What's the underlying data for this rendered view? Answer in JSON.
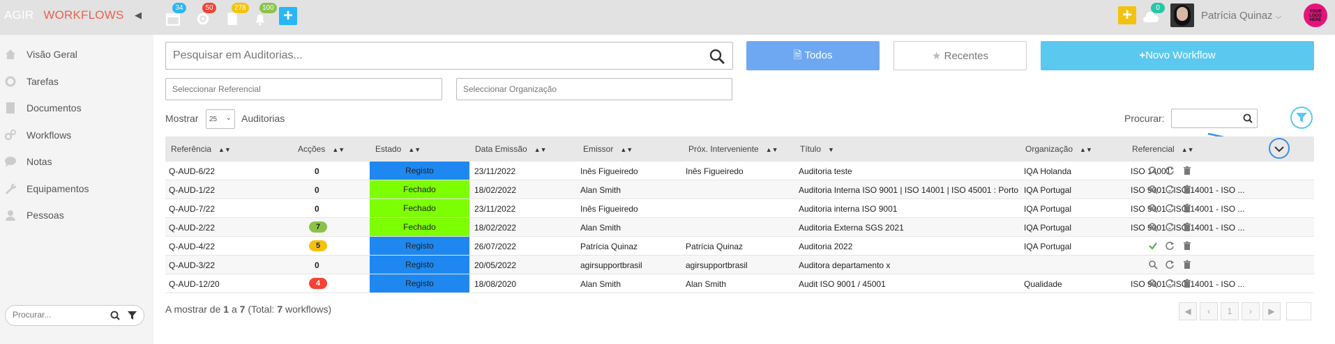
{
  "colors": {
    "accent": "#5bc9ef",
    "registo": "#1e88f0",
    "fechado": "#7cff00",
    "pill_green": "#8bc34a",
    "pill_yellow": "#f4c20d",
    "pill_red": "#f44336"
  },
  "brand": {
    "part1": "AGIR",
    "part2": "WORKFLOWS"
  },
  "topbar": {
    "badges": [
      "34",
      "50",
      "278",
      "100"
    ],
    "notif_count": "0",
    "user_name": "Patrícia Quinaz",
    "logo_text": "YOUR LOGO HERE"
  },
  "sidebar": {
    "items": [
      {
        "label": "Visão Geral",
        "icon": "home-icon"
      },
      {
        "label": "Tarefas",
        "icon": "gear-icon"
      },
      {
        "label": "Documentos",
        "icon": "document-icon"
      },
      {
        "label": "Workflows",
        "icon": "gears-icon"
      },
      {
        "label": "Notas",
        "icon": "chat-icon"
      },
      {
        "label": "Equipamentos",
        "icon": "wrench-icon"
      },
      {
        "label": "Pessoas",
        "icon": "user-icon"
      }
    ],
    "search_placeholder": "Procurar..."
  },
  "main": {
    "search_placeholder": "Pesquisar em Auditorias...",
    "btn_todos": "Todos",
    "btn_recentes": "Recentes",
    "btn_novo": "Novo Workflow",
    "filter_referencial": "Seleccionar Referencial",
    "filter_organizacao": "Seleccionar Organização",
    "mostrar": "Mostrar",
    "page_size": "25",
    "auditorias": "Auditorias",
    "procurar": "Procurar:"
  },
  "table": {
    "headers": [
      "Referência",
      "Acções",
      "Estado",
      "Data Emissão",
      "Emissor",
      "Próx. Interveniente",
      "Título",
      "Organização",
      "Referencial"
    ],
    "rows": [
      {
        "ref": "Q-AUD-6/22",
        "accoes": "0",
        "pill": "",
        "estado": "Registo",
        "data": "23/11/2022",
        "emissor": "Inês Figueiredo",
        "prox": "Inês Figueiredo",
        "titulo": "Auditoria teste",
        "org": "IQA Holanda",
        "referencial": "ISO 14001",
        "check": false
      },
      {
        "ref": "Q-AUD-1/22",
        "accoes": "0",
        "pill": "",
        "estado": "Fechado",
        "data": "18/02/2022",
        "emissor": "Alan Smith",
        "prox": "",
        "titulo": "Auditoria Interna ISO 9001 | ISO 14001 | ISO 45001 : Porto",
        "org": "IQA Portugal",
        "referencial": "ISO 9001 - ISO 14001 - ISO ...",
        "check": false
      },
      {
        "ref": "Q-AUD-7/22",
        "accoes": "0",
        "pill": "",
        "estado": "Fechado",
        "data": "23/11/2022",
        "emissor": "Inês Figueiredo",
        "prox": "",
        "titulo": "Auditoria interna ISO 9001",
        "org": "IQA Portugal",
        "referencial": "ISO 9001 - ISO 14001 - ISO ...",
        "check": false
      },
      {
        "ref": "Q-AUD-2/22",
        "accoes": "7",
        "pill": "green",
        "estado": "Fechado",
        "data": "18/02/2022",
        "emissor": "Alan Smith",
        "prox": "",
        "titulo": "Auditoria Externa SGS 2021",
        "org": "IQA Portugal",
        "referencial": "ISO 9001 - ISO 14001 - ISO ...",
        "check": false
      },
      {
        "ref": "Q-AUD-4/22",
        "accoes": "5",
        "pill": "yellow",
        "estado": "Registo",
        "data": "26/07/2022",
        "emissor": "Patrícia Quinaz",
        "prox": "Patrícia Quinaz",
        "titulo": "Auditoria 2022",
        "org": "IQA Portugal",
        "referencial": "",
        "check": true
      },
      {
        "ref": "Q-AUD-3/22",
        "accoes": "0",
        "pill": "",
        "estado": "Registo",
        "data": "20/05/2022",
        "emissor": "agirsupportbrasil",
        "prox": "agirsupportbrasil",
        "titulo": "Auditora departamento x",
        "org": "",
        "referencial": "",
        "check": false
      },
      {
        "ref": "Q-AUD-12/20",
        "accoes": "4",
        "pill": "red",
        "estado": "Registo",
        "data": "18/08/2020",
        "emissor": "Alan Smith",
        "prox": "Alan Smith",
        "titulo": "Audit ISO 9001 / 45001",
        "org": "Qualidade",
        "referencial": "ISO 9001 - ISO 14001 - ISO ...",
        "check": false
      }
    ]
  },
  "footer": {
    "info_prefix": "A mostrar de ",
    "from": "1",
    "mid": " a ",
    "to": "7",
    "total_prefix": " (Total: ",
    "total": "7",
    "total_suffix": " workflows)",
    "page": "1"
  }
}
